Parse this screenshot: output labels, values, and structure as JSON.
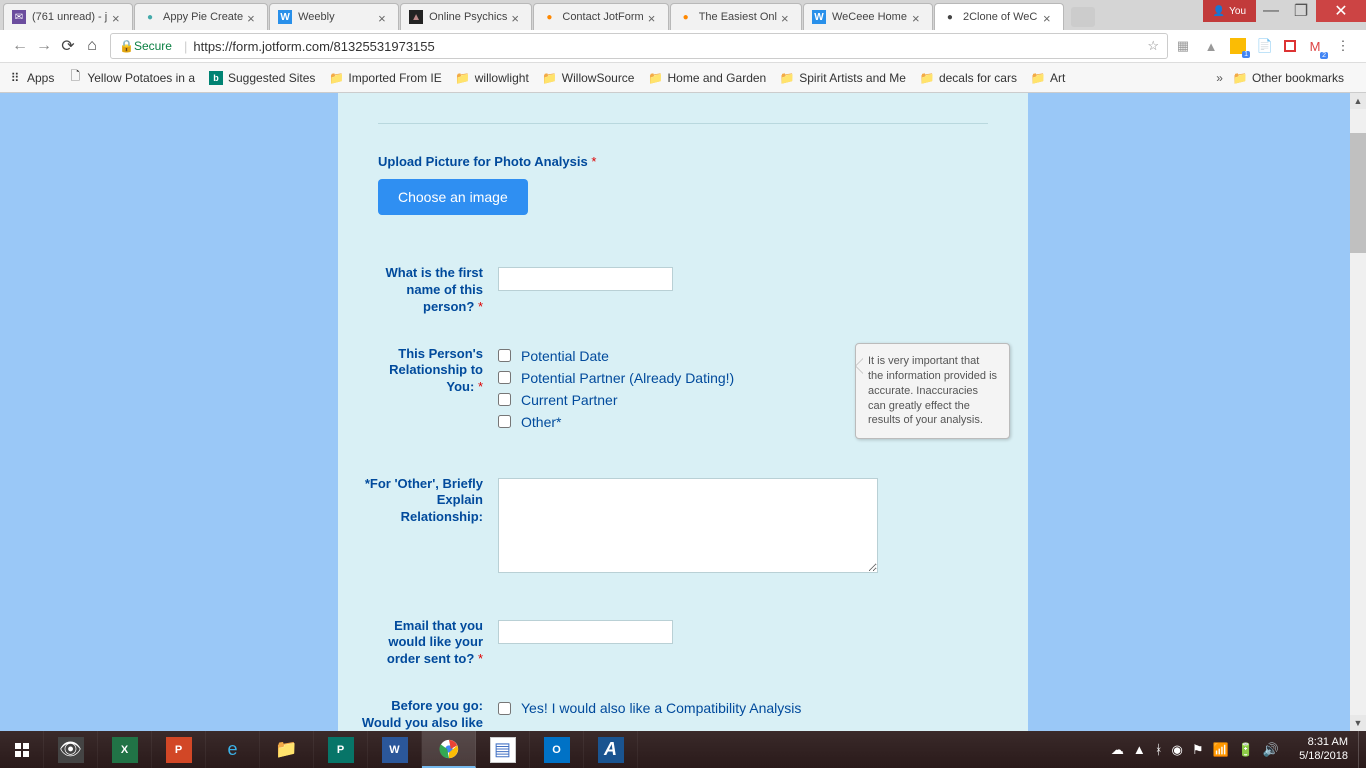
{
  "tabs": [
    {
      "title": "(761 unread) - j",
      "icon": "✉"
    },
    {
      "title": "Appy Pie Create",
      "icon": "●"
    },
    {
      "title": "Weebly",
      "icon": "W"
    },
    {
      "title": "Online Psychics",
      "icon": "▲"
    },
    {
      "title": "Contact JotForm",
      "icon": "●"
    },
    {
      "title": "The Easiest Onl",
      "icon": "●"
    },
    {
      "title": "WeCeee Home",
      "icon": "W"
    },
    {
      "title": "2Clone of WeC",
      "icon": "●",
      "active": true
    }
  ],
  "window": {
    "user": "You"
  },
  "address": {
    "secure": "Secure",
    "url": "https://form.jotform.com/81325531973155"
  },
  "bookmarks": {
    "appsLabel": "Apps",
    "items": [
      {
        "label": "Yellow Potatoes in a",
        "type": "page"
      },
      {
        "label": "Suggested Sites",
        "type": "bing"
      },
      {
        "label": "Imported From IE",
        "type": "folder"
      },
      {
        "label": "willowlight",
        "type": "folder"
      },
      {
        "label": "WillowSource",
        "type": "folder"
      },
      {
        "label": "Home and Garden",
        "type": "folder"
      },
      {
        "label": "Spirit Artists and Me",
        "type": "folder"
      },
      {
        "label": "decals for cars",
        "type": "folder"
      },
      {
        "label": "Art",
        "type": "folder"
      }
    ],
    "other": "Other bookmarks"
  },
  "form": {
    "upload": {
      "label": "Upload Picture for Photo Analysis",
      "button": "Choose an image"
    },
    "firstname": {
      "label": "What is the first name of this person?"
    },
    "relationship": {
      "label": "This Person's Relationship to You:",
      "options": [
        "Potential Date",
        "Potential Partner (Already Dating!)",
        "Current Partner",
        "Other*"
      ]
    },
    "other": {
      "label": "*For 'Other', Briefly Explain Relationship:"
    },
    "email": {
      "label": "Email that you would like your order sent to?"
    },
    "compat": {
      "label": "Before you go: Would you also like a Compatibility Analysis for an",
      "option": "Yes! I would also like a Compatibility Analysis"
    }
  },
  "tooltip": "It is very important that the information provided is accurate. Inaccuracies can greatly effect the results of your analysis.",
  "clock": {
    "time": "8:31 AM",
    "date": "5/18/2018"
  }
}
